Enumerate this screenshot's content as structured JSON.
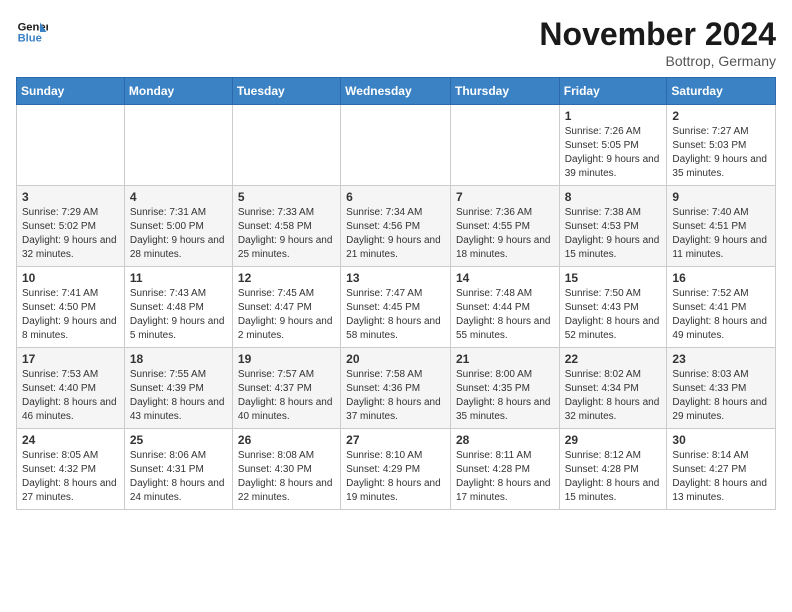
{
  "logo": {
    "line1": "General",
    "line2": "Blue"
  },
  "title": "November 2024",
  "location": "Bottrop, Germany",
  "days_header": [
    "Sunday",
    "Monday",
    "Tuesday",
    "Wednesday",
    "Thursday",
    "Friday",
    "Saturday"
  ],
  "weeks": [
    [
      {
        "day": "",
        "info": ""
      },
      {
        "day": "",
        "info": ""
      },
      {
        "day": "",
        "info": ""
      },
      {
        "day": "",
        "info": ""
      },
      {
        "day": "",
        "info": ""
      },
      {
        "day": "1",
        "info": "Sunrise: 7:26 AM\nSunset: 5:05 PM\nDaylight: 9 hours and 39 minutes."
      },
      {
        "day": "2",
        "info": "Sunrise: 7:27 AM\nSunset: 5:03 PM\nDaylight: 9 hours and 35 minutes."
      }
    ],
    [
      {
        "day": "3",
        "info": "Sunrise: 7:29 AM\nSunset: 5:02 PM\nDaylight: 9 hours and 32 minutes."
      },
      {
        "day": "4",
        "info": "Sunrise: 7:31 AM\nSunset: 5:00 PM\nDaylight: 9 hours and 28 minutes."
      },
      {
        "day": "5",
        "info": "Sunrise: 7:33 AM\nSunset: 4:58 PM\nDaylight: 9 hours and 25 minutes."
      },
      {
        "day": "6",
        "info": "Sunrise: 7:34 AM\nSunset: 4:56 PM\nDaylight: 9 hours and 21 minutes."
      },
      {
        "day": "7",
        "info": "Sunrise: 7:36 AM\nSunset: 4:55 PM\nDaylight: 9 hours and 18 minutes."
      },
      {
        "day": "8",
        "info": "Sunrise: 7:38 AM\nSunset: 4:53 PM\nDaylight: 9 hours and 15 minutes."
      },
      {
        "day": "9",
        "info": "Sunrise: 7:40 AM\nSunset: 4:51 PM\nDaylight: 9 hours and 11 minutes."
      }
    ],
    [
      {
        "day": "10",
        "info": "Sunrise: 7:41 AM\nSunset: 4:50 PM\nDaylight: 9 hours and 8 minutes."
      },
      {
        "day": "11",
        "info": "Sunrise: 7:43 AM\nSunset: 4:48 PM\nDaylight: 9 hours and 5 minutes."
      },
      {
        "day": "12",
        "info": "Sunrise: 7:45 AM\nSunset: 4:47 PM\nDaylight: 9 hours and 2 minutes."
      },
      {
        "day": "13",
        "info": "Sunrise: 7:47 AM\nSunset: 4:45 PM\nDaylight: 8 hours and 58 minutes."
      },
      {
        "day": "14",
        "info": "Sunrise: 7:48 AM\nSunset: 4:44 PM\nDaylight: 8 hours and 55 minutes."
      },
      {
        "day": "15",
        "info": "Sunrise: 7:50 AM\nSunset: 4:43 PM\nDaylight: 8 hours and 52 minutes."
      },
      {
        "day": "16",
        "info": "Sunrise: 7:52 AM\nSunset: 4:41 PM\nDaylight: 8 hours and 49 minutes."
      }
    ],
    [
      {
        "day": "17",
        "info": "Sunrise: 7:53 AM\nSunset: 4:40 PM\nDaylight: 8 hours and 46 minutes."
      },
      {
        "day": "18",
        "info": "Sunrise: 7:55 AM\nSunset: 4:39 PM\nDaylight: 8 hours and 43 minutes."
      },
      {
        "day": "19",
        "info": "Sunrise: 7:57 AM\nSunset: 4:37 PM\nDaylight: 8 hours and 40 minutes."
      },
      {
        "day": "20",
        "info": "Sunrise: 7:58 AM\nSunset: 4:36 PM\nDaylight: 8 hours and 37 minutes."
      },
      {
        "day": "21",
        "info": "Sunrise: 8:00 AM\nSunset: 4:35 PM\nDaylight: 8 hours and 35 minutes."
      },
      {
        "day": "22",
        "info": "Sunrise: 8:02 AM\nSunset: 4:34 PM\nDaylight: 8 hours and 32 minutes."
      },
      {
        "day": "23",
        "info": "Sunrise: 8:03 AM\nSunset: 4:33 PM\nDaylight: 8 hours and 29 minutes."
      }
    ],
    [
      {
        "day": "24",
        "info": "Sunrise: 8:05 AM\nSunset: 4:32 PM\nDaylight: 8 hours and 27 minutes."
      },
      {
        "day": "25",
        "info": "Sunrise: 8:06 AM\nSunset: 4:31 PM\nDaylight: 8 hours and 24 minutes."
      },
      {
        "day": "26",
        "info": "Sunrise: 8:08 AM\nSunset: 4:30 PM\nDaylight: 8 hours and 22 minutes."
      },
      {
        "day": "27",
        "info": "Sunrise: 8:10 AM\nSunset: 4:29 PM\nDaylight: 8 hours and 19 minutes."
      },
      {
        "day": "28",
        "info": "Sunrise: 8:11 AM\nSunset: 4:28 PM\nDaylight: 8 hours and 17 minutes."
      },
      {
        "day": "29",
        "info": "Sunrise: 8:12 AM\nSunset: 4:28 PM\nDaylight: 8 hours and 15 minutes."
      },
      {
        "day": "30",
        "info": "Sunrise: 8:14 AM\nSunset: 4:27 PM\nDaylight: 8 hours and 13 minutes."
      }
    ]
  ]
}
